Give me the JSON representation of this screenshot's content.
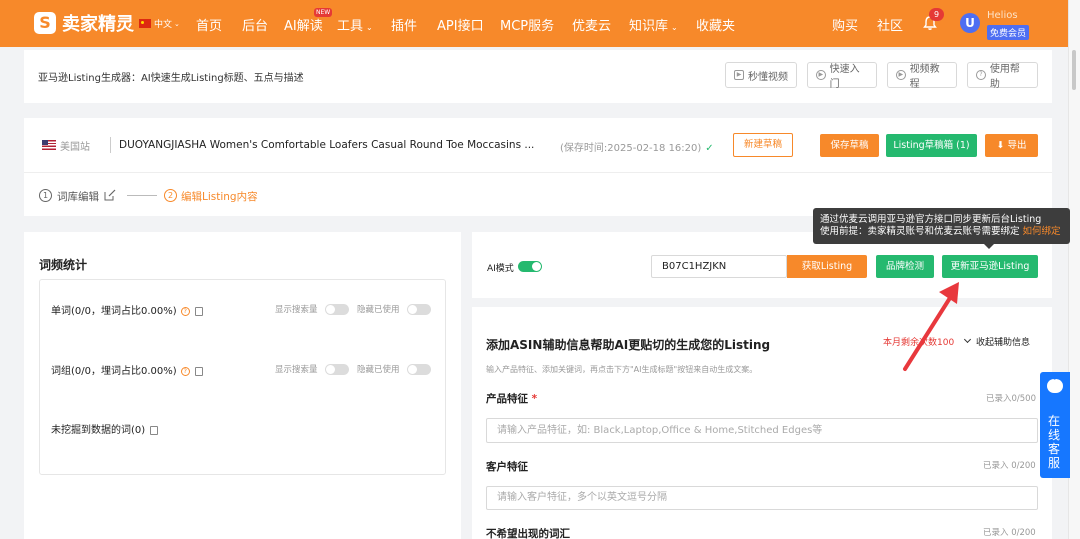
{
  "header": {
    "logo_mark": "S",
    "logo_text": "卖家精灵",
    "lang": "中文",
    "nav": [
      "首页",
      "后台",
      "AI解读",
      "工具",
      "插件",
      "API接口",
      "MCP服务",
      "优麦云",
      "知识库",
      "收藏夹"
    ],
    "new_badge": "NEW",
    "right_nav": [
      "购买",
      "社区"
    ],
    "notification_count": "9",
    "avatar_letter": "U",
    "user_name": "Helios",
    "member_tag": "免费会员"
  },
  "page": {
    "title": "亚马逊Listing生成器：AI快速生成Listing标题、五点与描述",
    "help_buttons": [
      "秒懂视频",
      "快速入门",
      "视频教程",
      "使用帮助"
    ]
  },
  "listing": {
    "site": "美国站",
    "product_title": "DUOYANGJIASHA Women's Comfortable Loafers Casual Round Toe Moccasins ...",
    "saved_time": "(保存时间:2025-02-18 16:20)",
    "check_mark": "✓",
    "new_draft": "新建草稿",
    "save_draft": "保存草稿",
    "listing_draft": "Listing草稿箱 (1)",
    "export": "导出"
  },
  "steps": {
    "step1_num": "1",
    "step1_label": "词库编辑",
    "step2_num": "2",
    "step2_label": "编辑Listing内容"
  },
  "stats": {
    "title": "词频统计",
    "words": "单词(0/0，埋词占比0.00%)",
    "phrases": "词组(0/0，埋词占比0.00%)",
    "unmined": "未挖掘到数据的词(0)",
    "show_volume": "显示搜索量",
    "hide_used": "隐藏已使用"
  },
  "ai": {
    "mode_label": "AI模式",
    "mode_on": true,
    "asin_value": "B07C1HZJKN",
    "get_listing": "获取Listing",
    "brand_check": "品牌检测",
    "update_amazon": "更新亚马逊Listing",
    "tooltip_line1": "通过优麦云调用亚马逊官方接口同步更新后台Listing",
    "tooltip_line2": "使用前提：卖家精灵账号和优麦云账号需要绑定",
    "tooltip_link": "如何绑定"
  },
  "form": {
    "title": "添加ASIN辅助信息帮助AI更贴切的生成您的Listing",
    "monthly_left": "本月剩余次数100",
    "collapse": "收起辅助信息",
    "hint": "输入产品特征、添加关键词，再点击下方\"AI生成标题\"按钮来自动生成文案。",
    "product_feature_label": "产品特征",
    "required_mark": "*",
    "product_feature_count": "已录入0/500",
    "product_feature_placeholder": "请输入产品特征，如: Black,Laptop,Office & Home,Stitched Edges等",
    "customer_feature_label": "客户特征",
    "customer_feature_count": "已录入 0/200",
    "customer_feature_placeholder": "请输入客户特征，多个以英文逗号分隔",
    "unwanted_label": "不希望出现的词汇",
    "unwanted_count": "已录入 0/200"
  },
  "service": {
    "label": "在线客服"
  },
  "colors": {
    "brand_orange": "#f7892a",
    "green": "#25b96f",
    "blue": "#1677ff"
  }
}
